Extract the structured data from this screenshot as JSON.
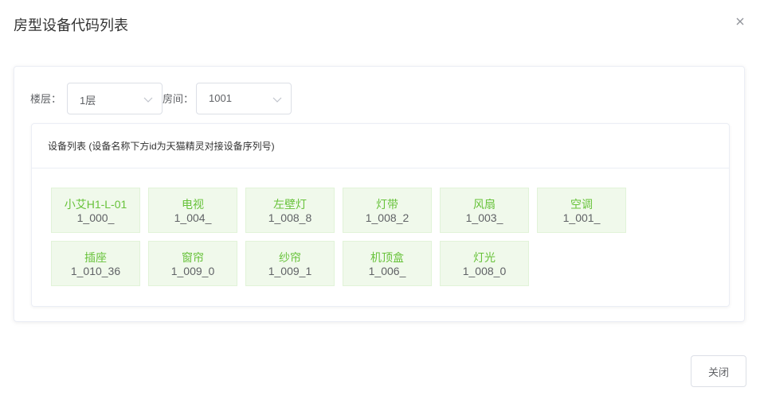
{
  "dialog": {
    "title": "房型设备代码列表",
    "close_icon": "close-icon",
    "footer_close_label": "关闭"
  },
  "filters": {
    "floor_label": "楼层：",
    "floor_value": "1层",
    "room_label": "房间：",
    "room_value": "1001"
  },
  "device_list": {
    "header": "设备列表 (设备名称下方id为天猫精灵对接设备序列号)",
    "items": [
      {
        "name": "小艾H1-L-01",
        "code": "1_000_"
      },
      {
        "name": "电视",
        "code": "1_004_"
      },
      {
        "name": "左壁灯",
        "code": "1_008_8"
      },
      {
        "name": "灯带",
        "code": "1_008_2"
      },
      {
        "name": "风扇",
        "code": "1_003_"
      },
      {
        "name": "空调",
        "code": "1_001_"
      },
      {
        "name": "插座",
        "code": "1_010_36"
      },
      {
        "name": "窗帘",
        "code": "1_009_0"
      },
      {
        "name": "纱帘",
        "code": "1_009_1"
      },
      {
        "name": "机顶盒",
        "code": "1_006_"
      },
      {
        "name": "灯光",
        "code": "1_008_0"
      }
    ]
  },
  "colors": {
    "accent_green": "#67c23a",
    "item_bg": "#f0f9eb",
    "item_border": "#e1f3d8"
  }
}
